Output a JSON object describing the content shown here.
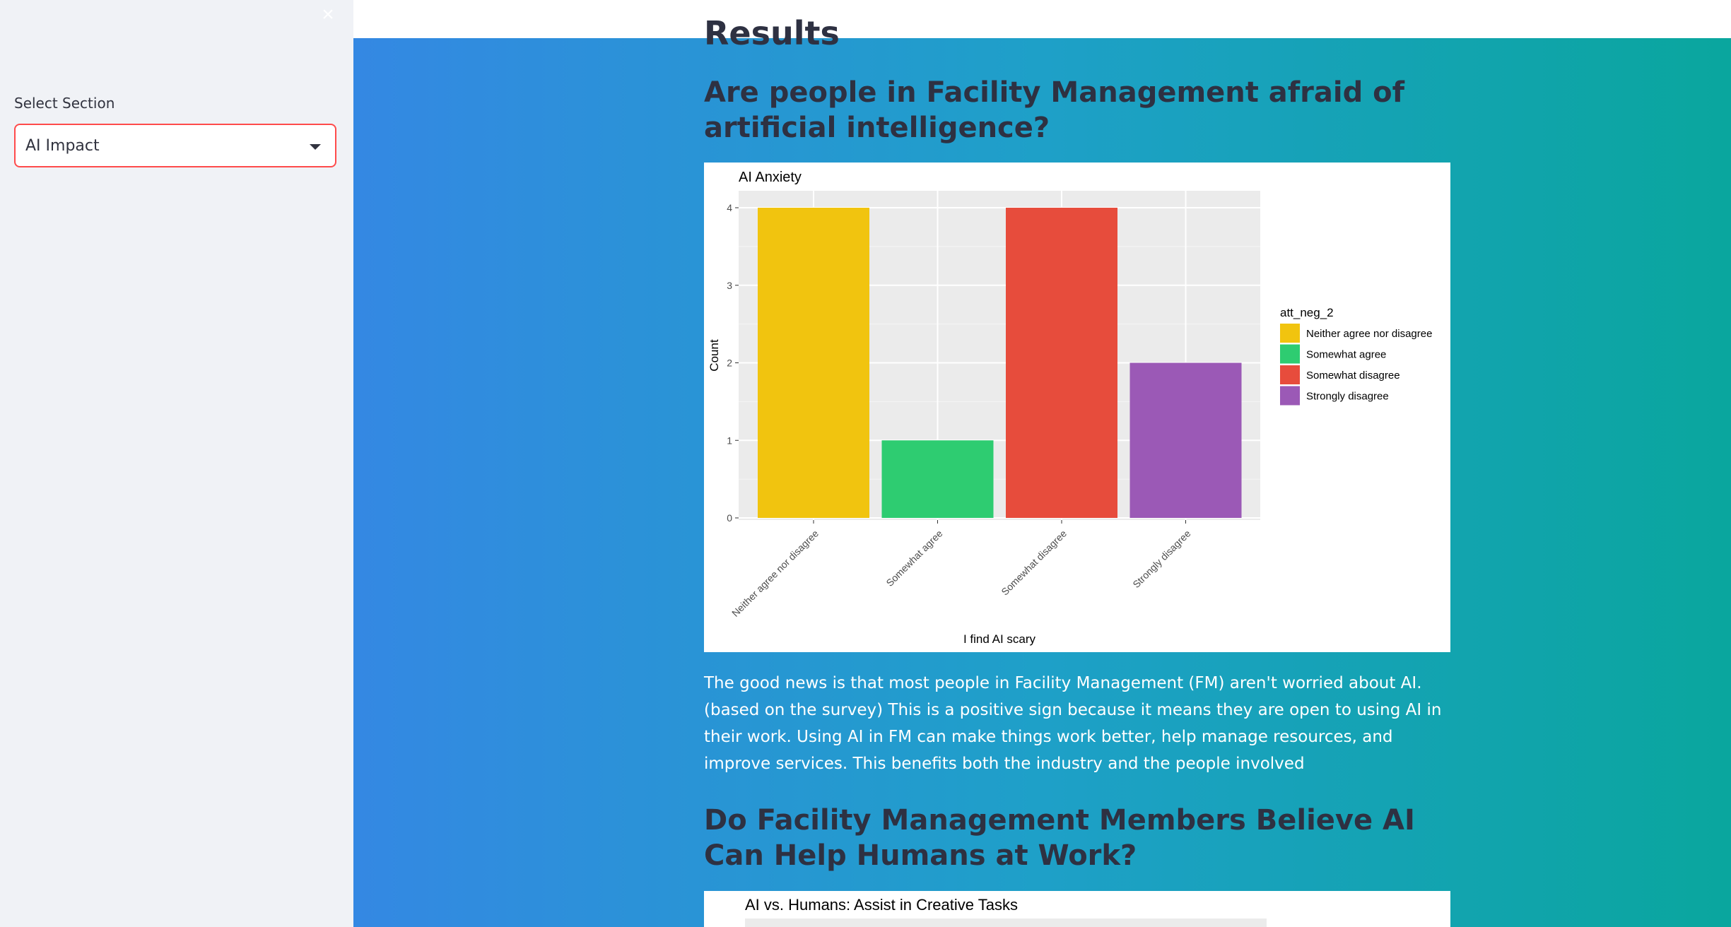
{
  "sidebar": {
    "close_icon": "×",
    "select_label": "Select Section",
    "select_value": "AI Impact"
  },
  "main": {
    "cut_title": "Results",
    "question_1": "Are people in Facility Management afraid of artificial intelligence?",
    "paragraph_1": "The good news is that most people in Facility Management (FM) aren't worried about AI. (based on the survey) This is a positive sign because it means they are open to using AI in their work. Using AI in FM can make things work better, help manage resources, and improve services. This benefits both the industry and the people involved",
    "question_2": "Do Facility Management Members Believe AI Can Help Humans at Work?",
    "chart_2_title": "AI vs. Humans: Assist in Creative Tasks"
  },
  "chart_data": [
    {
      "type": "bar",
      "title": "AI Anxiety",
      "xlabel": "I find AI scary",
      "ylabel": "Count",
      "categories": [
        "Neither agree nor disagree",
        "Somewhat agree",
        "Somewhat disagree",
        "Strongly disagree"
      ],
      "values": [
        4,
        1,
        4,
        2
      ],
      "colors": [
        "#f1c40f",
        "#2ecc71",
        "#e74c3c",
        "#9b59b6"
      ],
      "ylim": [
        0,
        4
      ],
      "yticks": [
        0,
        1,
        2,
        3,
        4
      ],
      "legend_title": "att_neg_2",
      "legend_position": "right",
      "grid": true
    }
  ]
}
